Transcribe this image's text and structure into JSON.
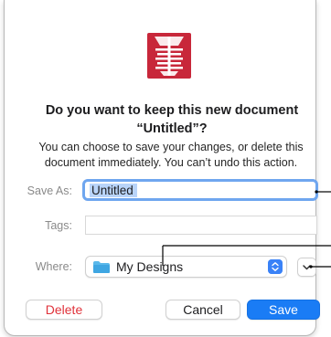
{
  "dialog": {
    "title": "Do you want to keep this new document “Untitled”?",
    "message": "You can choose to save your changes, or delete this document immediately. You can’t undo this action."
  },
  "form": {
    "save_as_label": "Save As:",
    "save_as_value": "Untitled",
    "tags_label": "Tags:",
    "tags_value": "",
    "where_label": "Where:",
    "where_value": "My Designs"
  },
  "buttons": {
    "delete": "Delete",
    "cancel": "Cancel",
    "save": "Save"
  },
  "icons": {
    "app": "app-icon",
    "folder": "folder-icon",
    "stepper": "popup-stepper-icon",
    "expand": "chevron-down-icon"
  },
  "colors": {
    "accent": "#1a7cf5",
    "delete_text": "#e0323a",
    "app_icon": "#c8273a",
    "folder": "#5ab8ea"
  }
}
